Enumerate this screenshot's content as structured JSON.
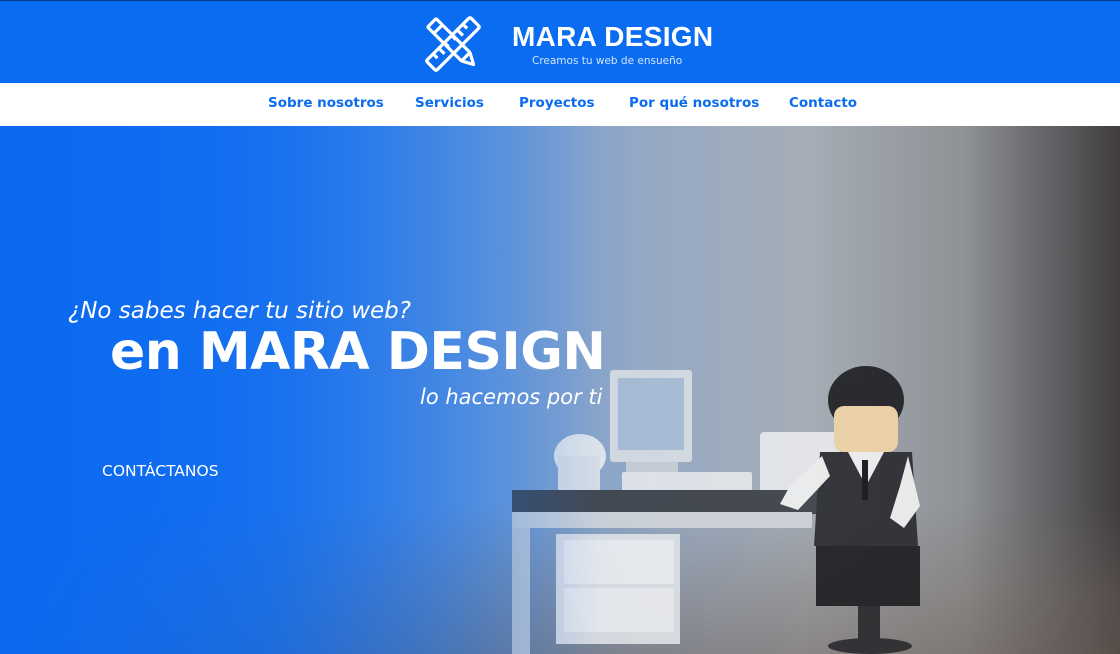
{
  "header": {
    "brand_name": "MARA DESIGN",
    "tagline": "Creamos tu web de ensueño",
    "logo_icon": "ruler-pencil-icon",
    "background_color": "#0a6cf0"
  },
  "nav": {
    "items": [
      {
        "label": "Sobre nosotros"
      },
      {
        "label": "Servicios"
      },
      {
        "label": "Proyectos"
      },
      {
        "label": "Por qué nosotros"
      },
      {
        "label": "Contacto"
      }
    ],
    "link_color": "#0a6cf0"
  },
  "hero": {
    "question": "¿No sabes hacer tu sitio web?",
    "title": "en MARA DESIGN",
    "subtitle": "lo hacemos por ti",
    "cta_label": "CONTÁCTANOS",
    "image": "lego-figure-at-desk-with-computer"
  }
}
